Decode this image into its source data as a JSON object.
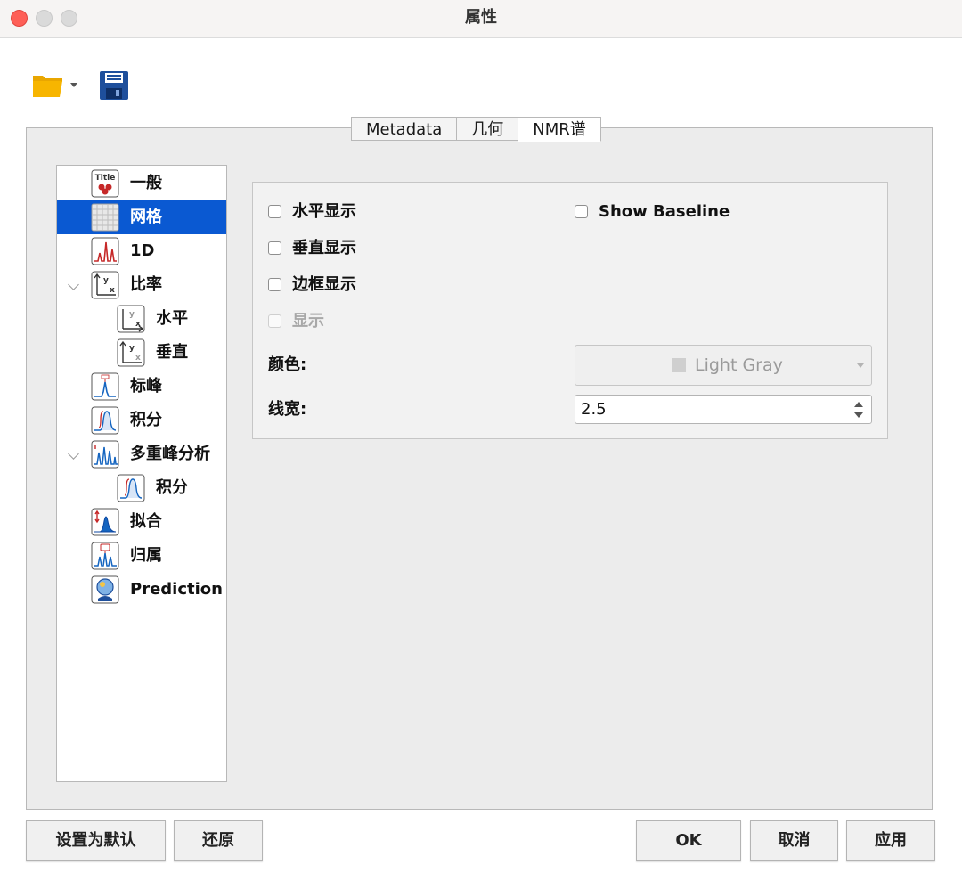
{
  "window": {
    "title": "属性"
  },
  "tabs": [
    {
      "label": "Metadata",
      "active": false
    },
    {
      "label": "几何",
      "active": false
    },
    {
      "label": "NMR谱",
      "active": true
    }
  ],
  "tree": {
    "items": [
      {
        "label": "一般",
        "icon": "title-icon",
        "selected": false
      },
      {
        "label": "网格",
        "icon": "grid-icon",
        "selected": true
      },
      {
        "label": "1D",
        "icon": "spectrum-1d-icon",
        "selected": false
      },
      {
        "label": "比率",
        "icon": "ratio-icon",
        "selected": false,
        "expanded": true
      },
      {
        "label": "水平",
        "icon": "ratio-horizontal-icon",
        "selected": false
      },
      {
        "label": "垂直",
        "icon": "ratio-vertical-icon",
        "selected": false
      },
      {
        "label": "标峰",
        "icon": "peak-label-icon",
        "selected": false
      },
      {
        "label": "积分",
        "icon": "integral-icon",
        "selected": false
      },
      {
        "label": "多重峰分析",
        "icon": "multiplet-icon",
        "selected": false,
        "expanded": true
      },
      {
        "label": "积分",
        "icon": "integral-icon",
        "selected": false
      },
      {
        "label": "拟合",
        "icon": "fitting-icon",
        "selected": false
      },
      {
        "label": "归属",
        "icon": "assignment-icon",
        "selected": false
      },
      {
        "label": "Prediction",
        "icon": "prediction-icon",
        "selected": false
      }
    ]
  },
  "grid_settings": {
    "horizontal": {
      "label": "水平显示",
      "checked": false
    },
    "vertical": {
      "label": "垂直显示",
      "checked": false
    },
    "frame": {
      "label": "边框显示",
      "checked": false
    },
    "show": {
      "label": "显示",
      "checked": false,
      "disabled": true
    },
    "show_baseline": {
      "label": "Show Baseline",
      "checked": false
    },
    "color": {
      "label": "颜色:",
      "value": "Light Gray",
      "swatch": "#cfcfcf"
    },
    "line_width": {
      "label": "线宽:",
      "value": "2.5"
    }
  },
  "buttons": {
    "set_default": "设置为默认",
    "restore": "还原",
    "ok": "OK",
    "cancel": "取消",
    "apply": "应用"
  }
}
